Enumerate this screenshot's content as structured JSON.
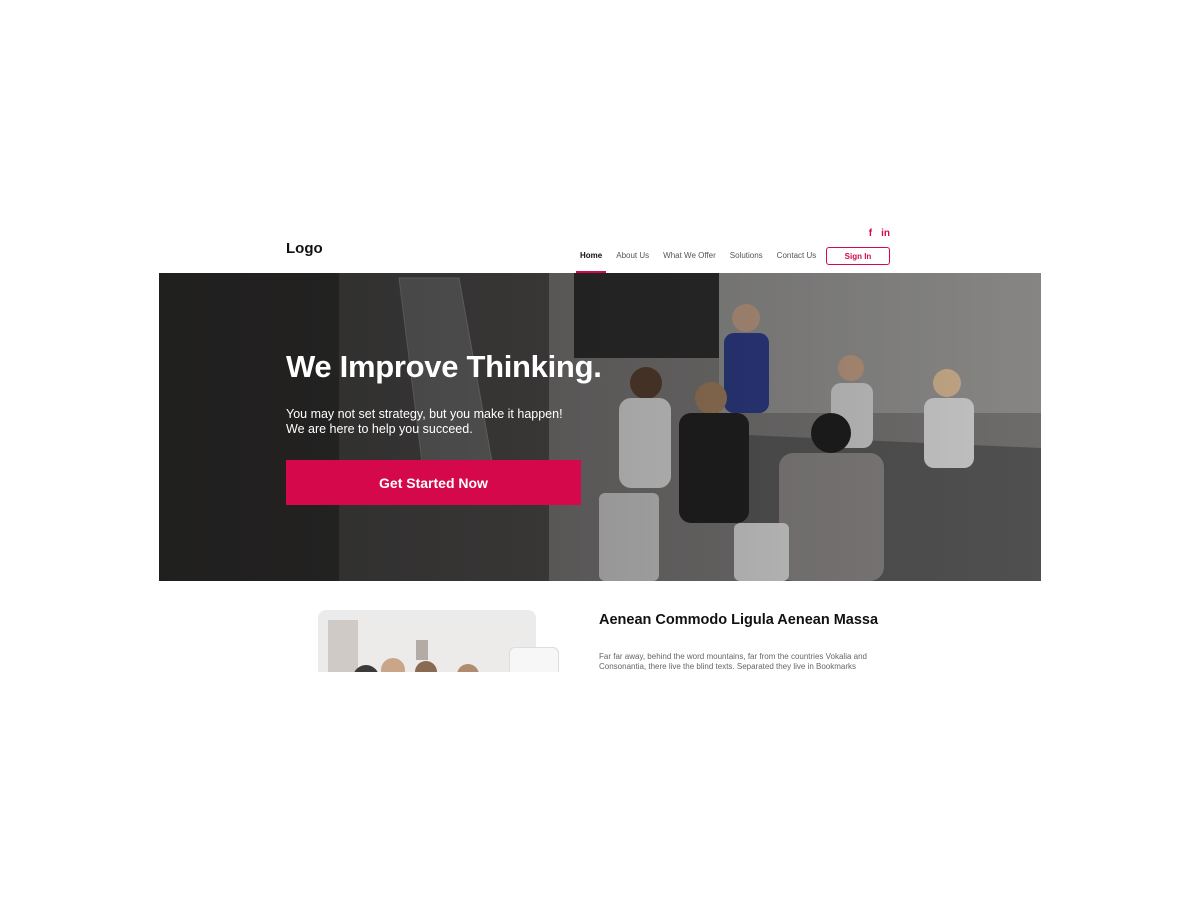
{
  "header": {
    "logo": "Logo",
    "social": [
      "f",
      "in"
    ],
    "nav": [
      {
        "label": "Home",
        "active": true
      },
      {
        "label": "About Us",
        "active": false
      },
      {
        "label": "What We Offer",
        "active": false
      },
      {
        "label": "Solutions",
        "active": false
      },
      {
        "label": "Contact Us",
        "active": false
      }
    ],
    "signin_label": "Sign In"
  },
  "hero": {
    "title": "We Improve Thinking.",
    "subtitle_line1": "You may not set strategy, but you make it happen!",
    "subtitle_line2": "We are here to help you succeed.",
    "cta_label": "Get Started Now"
  },
  "feature": {
    "title": "Aenean Commodo Ligula Aenean Massa",
    "body": "Far far away, behind the word mountains, far from the countries Vokalia and Consonantia, there live the blind texts. Separated they live in Bookmarks"
  },
  "colors": {
    "accent": "#d4084a",
    "text": "#111111",
    "muted": "#666666"
  }
}
